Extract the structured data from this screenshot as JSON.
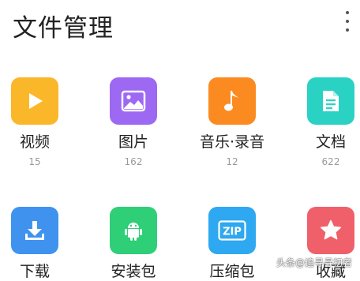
{
  "header": {
    "title": "文件管理",
    "menu_icon": "more-vertical-icon"
  },
  "categories": [
    {
      "label": "视频",
      "count": "15",
      "icon": "play-icon",
      "color": "#fbb72a"
    },
    {
      "label": "图片",
      "count": "162",
      "icon": "image-icon",
      "color": "#9d68f2"
    },
    {
      "label": "音乐·录音",
      "count": "12",
      "icon": "music-note-icon",
      "color": "#fb8b21"
    },
    {
      "label": "文档",
      "count": "622",
      "icon": "document-icon",
      "color": "#2ad2c4"
    },
    {
      "label": "下载",
      "icon": "download-icon",
      "color": "#3f93ef"
    },
    {
      "label": "安装包",
      "icon": "android-icon",
      "color": "#2fcf77"
    },
    {
      "label": "压缩包",
      "icon": "zip-icon",
      "color": "#2ea8f0",
      "icon_text": "ZIP"
    },
    {
      "label": "收藏",
      "icon": "star-icon",
      "color": "#f0606a"
    }
  ],
  "watermark": "头条@追寻寻初者"
}
